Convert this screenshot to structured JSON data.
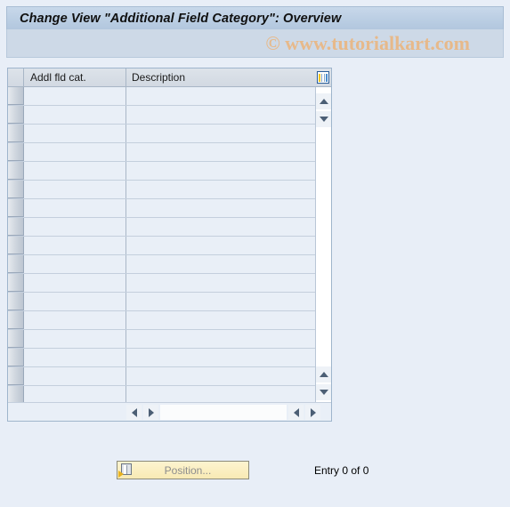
{
  "window": {
    "title": "Change View \"Additional Field Category\": Overview"
  },
  "watermark": {
    "text": "© www.tutorialkart.com"
  },
  "table": {
    "columns": [
      {
        "label": "Addl fld cat."
      },
      {
        "label": "Description"
      }
    ],
    "config_icon": "table-settings-icon",
    "row_count": 17,
    "rows": []
  },
  "scrollbars": {
    "vertical_up": "triangle-up-icon",
    "vertical_down": "triangle-down-icon",
    "horizontal_left": "triangle-left-icon",
    "horizontal_right": "triangle-right-icon"
  },
  "footer": {
    "position_button_label": "Position...",
    "position_button_icon": "position-goto-icon",
    "entry_status": "Entry 0 of 0"
  },
  "colors": {
    "title_bar": "#bccfe4",
    "watermark_band": "#cdd9e7",
    "page_background": "#e8eef7",
    "grid_cell": "#e9eff7",
    "button_yellow": "#f8eab4",
    "watermark_text": "#e7b98a"
  }
}
